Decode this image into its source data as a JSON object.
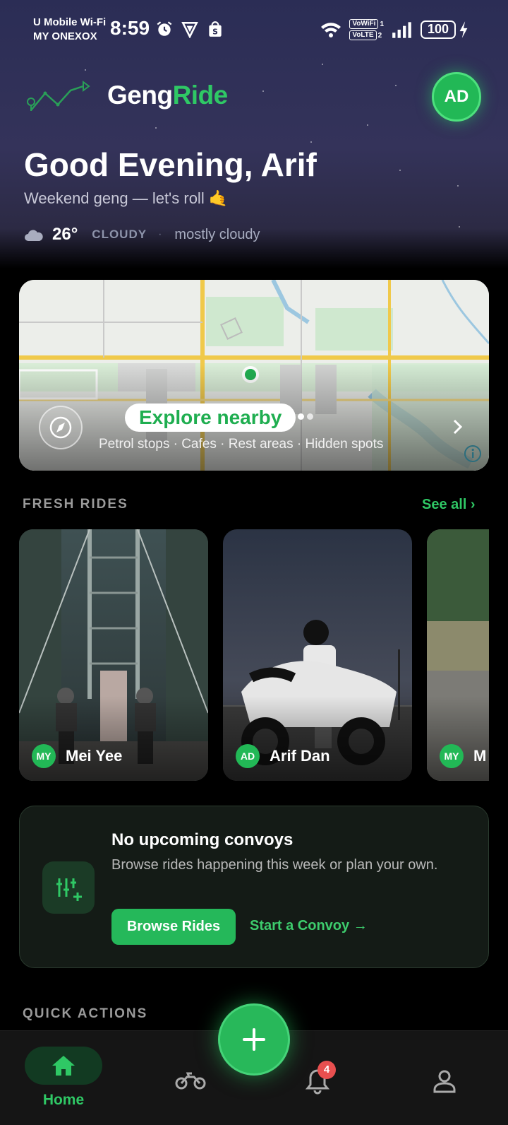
{
  "status_bar": {
    "carrier_line1": "U Mobile Wi-Fi",
    "carrier_line2": "MY ONEXOX",
    "time": "8:59",
    "vowifi": "VoWiFi",
    "volte": "VoLTE",
    "sim1": "1",
    "sim2": "2",
    "battery": "100"
  },
  "brand": {
    "part1": "Geng",
    "part2": "Ride"
  },
  "profile": {
    "initials": "AD"
  },
  "greeting": "Good Evening, Arif",
  "subtitle": "Weekend geng — let's roll 🤙",
  "weather": {
    "temperature": "26°",
    "condition": "CLOUDY",
    "separator": "·",
    "description": "mostly cloudy"
  },
  "explore": {
    "title": "Explore nearby",
    "tags": "Petrol stops · Cafes · Rest areas · Hidden spots"
  },
  "fresh_rides": {
    "section_title": "FRESH RIDES",
    "see_all": "See all ›",
    "rides": [
      {
        "initials": "MY",
        "name": "Mei Yee"
      },
      {
        "initials": "AD",
        "name": "Arif Dan"
      },
      {
        "initials": "MY",
        "name": "M"
      }
    ]
  },
  "convoy": {
    "title": "No upcoming convoys",
    "description": "Browse rides happening this week or plan your own.",
    "browse_label": "Browse Rides",
    "start_label": "Start a Convoy →"
  },
  "quick_actions": {
    "section_title": "QUICK ACTIONS"
  },
  "nav": {
    "home_label": "Home",
    "notification_count": "4"
  },
  "colors": {
    "accent": "#2fc865",
    "header_bg": "#2b2d55",
    "card_bg": "#141b16",
    "badge": "#e84f4f"
  }
}
